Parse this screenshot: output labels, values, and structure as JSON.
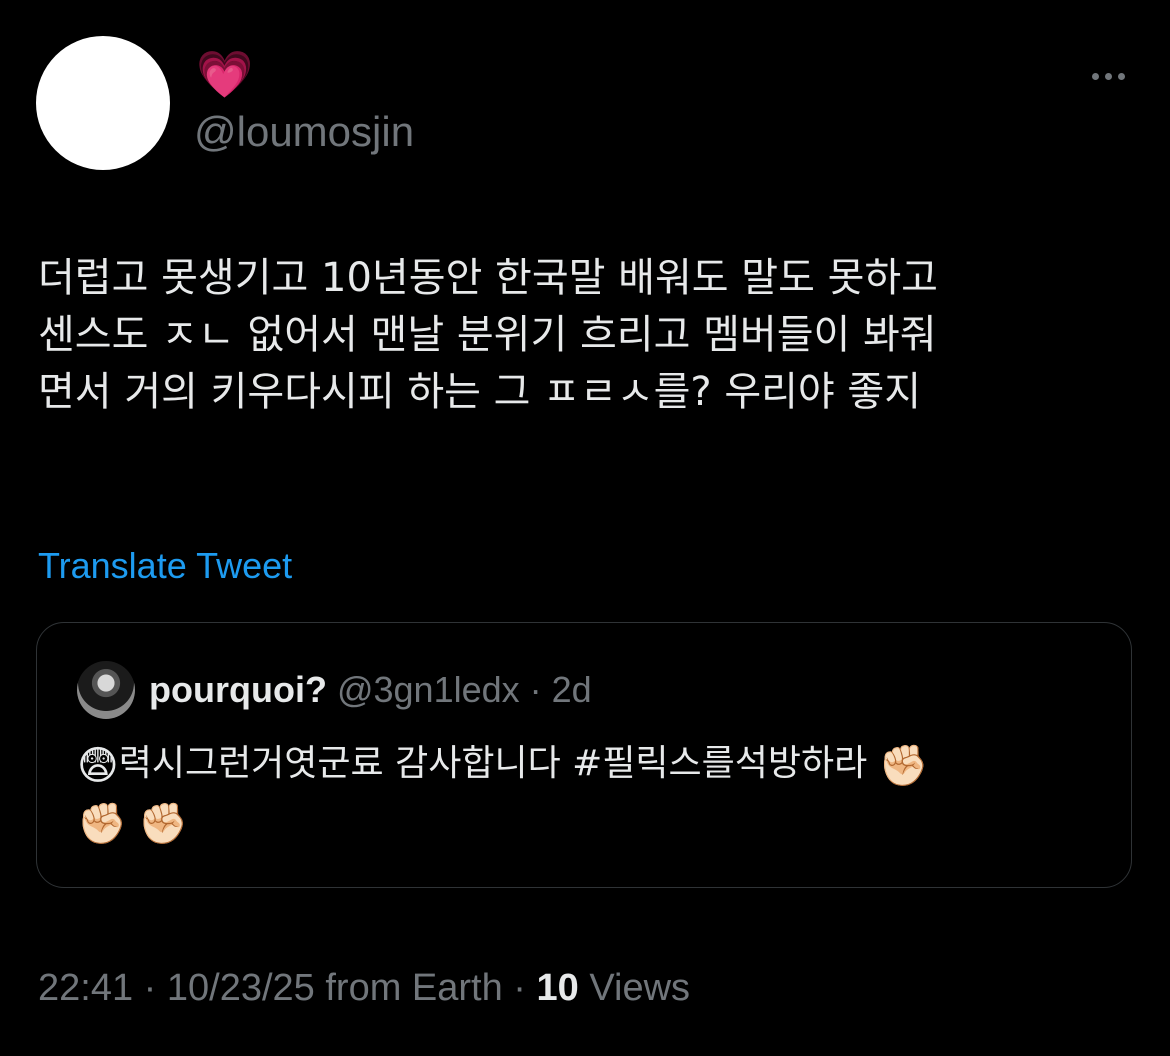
{
  "author": {
    "display_name": "💗",
    "handle": "@loumosjin"
  },
  "tweet": {
    "text": "더럽고 못생기고 10년동안 한국말 배워도 말도 못하고\n센스도 ㅈㄴ 없어서 맨날 분위기 흐리고 멤버들이 봐줘\n면서 거의 키우다시피 하는 그 ㅍㄹㅅ를? 우리야 좋지",
    "translate_label": "Translate Tweet"
  },
  "quote": {
    "display_name": "pourquoi?",
    "handle": "@3gn1ledx",
    "separator": " · ",
    "age": "2d",
    "emoji_lead": "😨",
    "text": "력시그런거엿군료 감사합니다 #필릭스를석방하라",
    "emoji_fists": [
      "✊🏻",
      "✊🏻",
      "✊🏻"
    ]
  },
  "footer": {
    "time": "22:41",
    "date": "10/23/25",
    "source": "from Earth",
    "separator": " · ",
    "views_count": "10",
    "views_label": "Views"
  },
  "colors": {
    "background": "#000000",
    "text_primary": "#e7e9ea",
    "text_secondary": "#71767b",
    "link": "#1d9bf0",
    "border": "#2f3336"
  },
  "icons": {
    "more": "more-horizontal-icon"
  }
}
